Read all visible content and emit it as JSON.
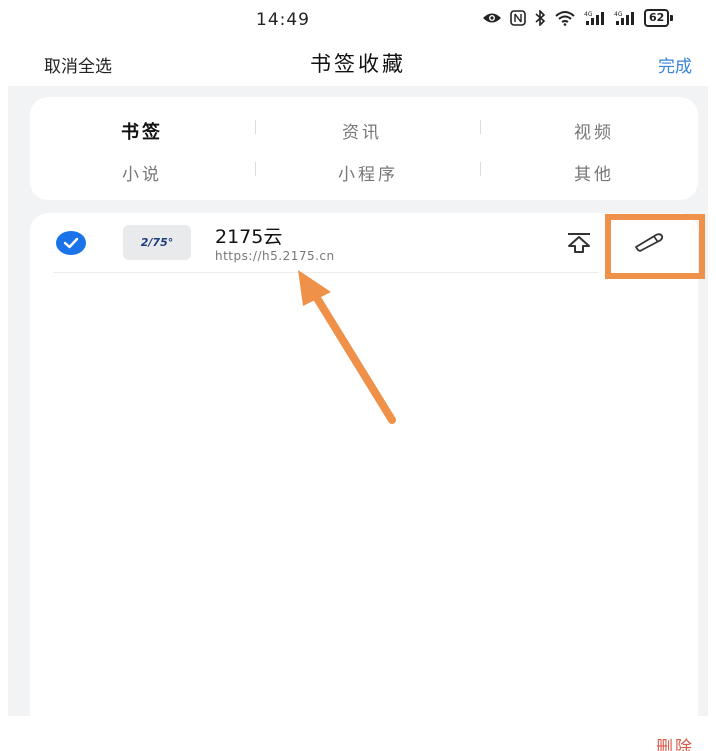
{
  "status_bar": {
    "time": "14:49",
    "battery": "62",
    "network_1": "4G",
    "network_2": "4G"
  },
  "header": {
    "left_label": "取消全选",
    "title": "书签收藏",
    "right_label": "完成",
    "accent_color": "#3a86d9"
  },
  "categories": [
    {
      "label": "书签",
      "active": true
    },
    {
      "label": "资讯",
      "active": false
    },
    {
      "label": "视频",
      "active": false
    },
    {
      "label": "小说",
      "active": false
    },
    {
      "label": "小程序",
      "active": false
    },
    {
      "label": "其他",
      "active": false
    }
  ],
  "bookmarks": [
    {
      "selected": true,
      "favicon_text": "2/75°",
      "title": "2175云",
      "url": "https://h5.2175.cn",
      "move_icon": "move-to-top-icon",
      "edit_icon": "pencil-icon"
    }
  ],
  "footer": {
    "delete_label": "删除",
    "delete_color": "#d95a4a"
  },
  "annotation": {
    "highlight_color": "#ef9149"
  }
}
